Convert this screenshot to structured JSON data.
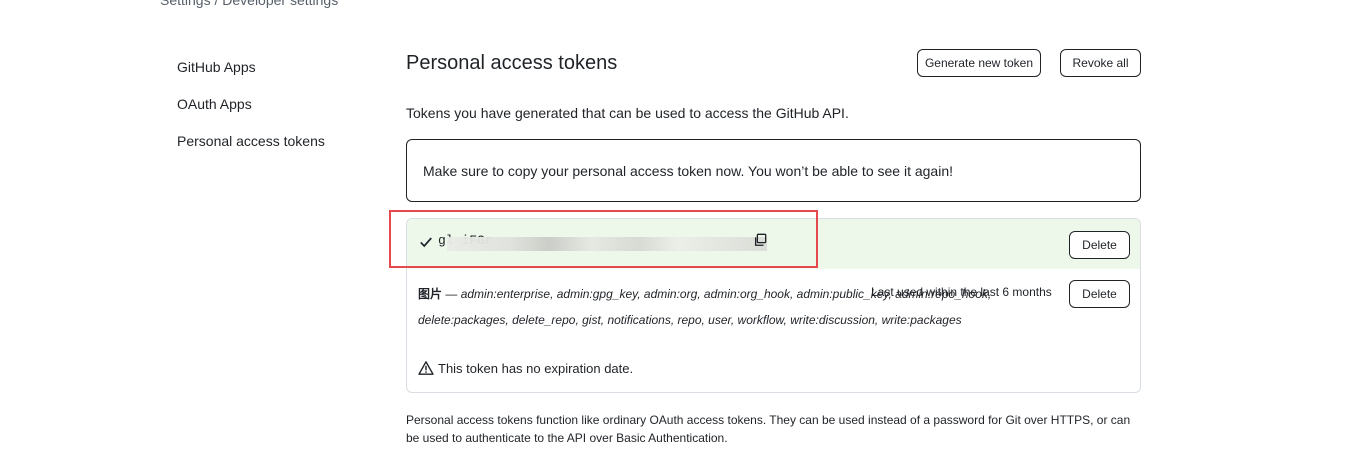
{
  "breadcrumb": "Settings / Developer settings",
  "sidebar": {
    "items": [
      {
        "label": "GitHub Apps"
      },
      {
        "label": "OAuth Apps"
      },
      {
        "label": "Personal access tokens"
      }
    ]
  },
  "header": {
    "title": "Personal access tokens",
    "generate_label": "Generate new token",
    "revoke_label": "Revoke all"
  },
  "intro_text": "Tokens you have generated that can be used to access the GitHub API.",
  "flash_text": "Make sure to copy your personal access token now. You won’t be able to see it again!",
  "tokens": [
    {
      "value_visible": "gl                                          iFGr",
      "delete_label": "Delete"
    },
    {
      "name": "图片",
      "separator": " — ",
      "scopes": "admin:enterprise, admin:gpg_key, admin:org, admin:org_hook, admin:public_key, admin:repo_hook, delete:packages, delete_repo, gist, notifications, repo, user, workflow, write:discussion, write:packages",
      "last_used": "Last used within the last 6 months",
      "expiry": "This token has no expiration date.",
      "delete_label": "Delete"
    }
  ],
  "footer_note": "Personal access tokens function like ordinary OAuth access tokens. They can be used instead of a password for Git over HTTPS, or can be used to authenticate to the API over Basic Authentication.",
  "icons": {
    "check": "check-icon",
    "copy": "copy-icon",
    "alert": "alert-icon"
  },
  "colors": {
    "new_token_bg": "#eef8ea",
    "highlight_border": "#e5484d"
  }
}
